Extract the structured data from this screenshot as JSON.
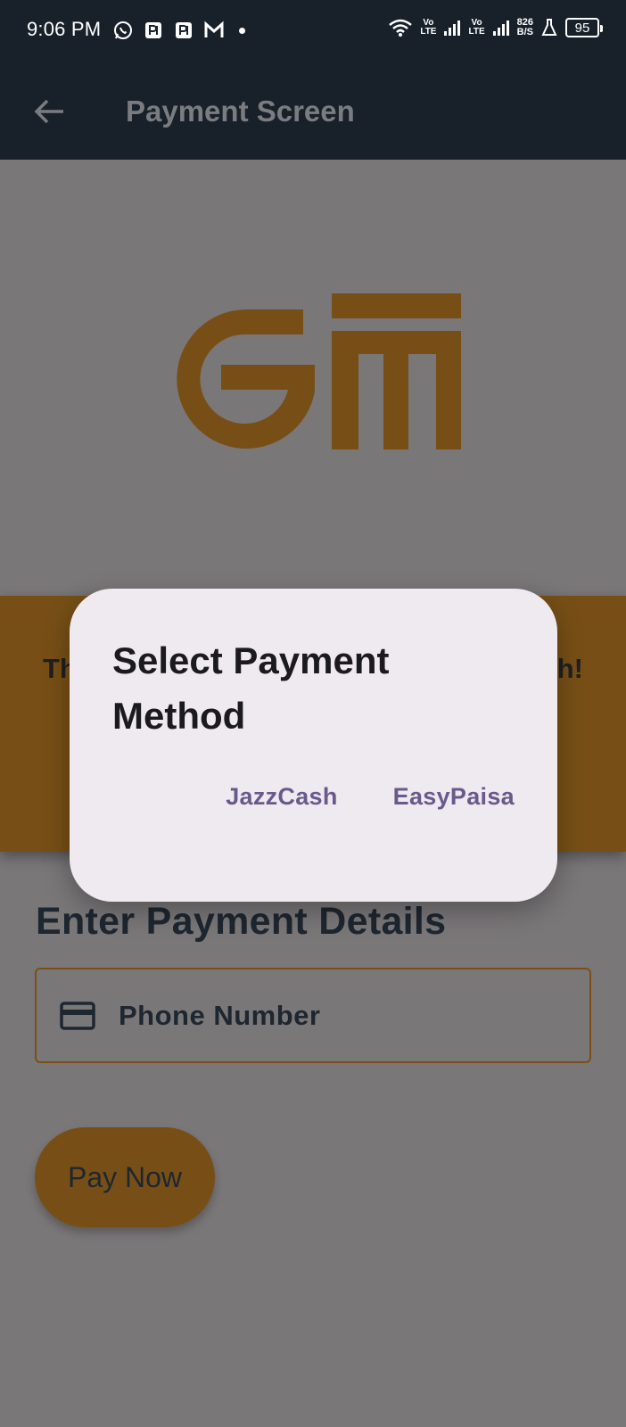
{
  "status_bar": {
    "time": "9:06 PM",
    "left_icons": [
      "whatsapp-icon",
      "paypak-icon",
      "paypak-icon",
      "gmail-icon",
      "notification-dot"
    ],
    "volte_1": [
      "Vo",
      "LTE"
    ],
    "volte_2": [
      "Vo",
      "LTE"
    ],
    "net_speed": [
      "826",
      "B/S"
    ],
    "battery": "95"
  },
  "app_bar": {
    "title": "Payment Screen",
    "back_icon": "arrow-left-icon"
  },
  "banner": {
    "text_start": "Th",
    "text_end": "h!"
  },
  "form": {
    "section_title": "Enter Payment Details",
    "phone_label": "Phone Number",
    "phone_icon": "credit-card-icon",
    "pay_button": "Pay Now"
  },
  "dialog": {
    "title": "Select Payment Method",
    "actions": [
      "JazzCash",
      "EasyPaisa"
    ]
  },
  "colors": {
    "header_bg": "#18202a",
    "scrim_bg": "#7a7779",
    "brand_gold": "#774f16",
    "dialog_bg": "#efe9f0",
    "dialog_action": "#6a5a8c"
  }
}
